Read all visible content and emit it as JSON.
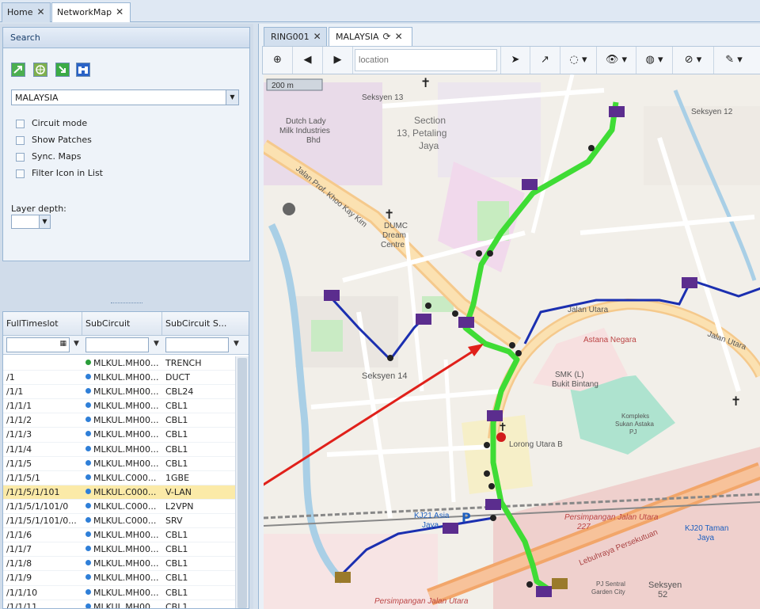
{
  "top_tabs": [
    {
      "label": "Home",
      "active": false
    },
    {
      "label": "NetworkMap",
      "active": true
    }
  ],
  "search_panel": {
    "title": "Search",
    "tool_icons": [
      "export-icon",
      "globe-icon",
      "import-icon",
      "binoculars-icon"
    ],
    "country": "MALAYSIA",
    "options": [
      "Circuit mode",
      "Show Patches",
      "Sync. Maps",
      "Filter Icon in List"
    ],
    "layer_depth_label": "Layer depth:"
  },
  "grid": {
    "columns": [
      "FullTimeslot",
      "SubCircuit",
      "SubCircuit S..."
    ],
    "rows": [
      {
        "slot": "",
        "sub": "MLKUL.MH00...",
        "status": "TRENCH",
        "dot": "#2a9d3a",
        "selected": false
      },
      {
        "slot": "/1",
        "sub": "MLKUL.MH00...",
        "status": "DUCT",
        "dot": "#2f7fd8",
        "selected": false
      },
      {
        "slot": "/1/1",
        "sub": "MLKUL.MH00...",
        "status": "CBL24",
        "dot": "#2f7fd8",
        "selected": false
      },
      {
        "slot": "/1/1/1",
        "sub": "MLKUL.MH00...",
        "status": "CBL1",
        "dot": "#2f7fd8",
        "selected": false
      },
      {
        "slot": "/1/1/2",
        "sub": "MLKUL.MH00...",
        "status": "CBL1",
        "dot": "#2f7fd8",
        "selected": false
      },
      {
        "slot": "/1/1/3",
        "sub": "MLKUL.MH00...",
        "status": "CBL1",
        "dot": "#2f7fd8",
        "selected": false
      },
      {
        "slot": "/1/1/4",
        "sub": "MLKUL.MH00...",
        "status": "CBL1",
        "dot": "#2f7fd8",
        "selected": false
      },
      {
        "slot": "/1/1/5",
        "sub": "MLKUL.MH00...",
        "status": "CBL1",
        "dot": "#2f7fd8",
        "selected": false
      },
      {
        "slot": "/1/1/5/1",
        "sub": "MLKUL.C000...",
        "status": "1GBE",
        "dot": "#2f7fd8",
        "selected": false
      },
      {
        "slot": "/1/1/5/1/101",
        "sub": "MLKUL.C000...",
        "status": "V-LAN",
        "dot": "#2f7fd8",
        "selected": true
      },
      {
        "slot": "/1/1/5/1/101/0",
        "sub": "MLKUL.C000...",
        "status": "L2VPN",
        "dot": "#2f7fd8",
        "selected": false
      },
      {
        "slot": "/1/1/5/1/101/0...",
        "sub": "MLKUL.C000...",
        "status": "SRV",
        "dot": "#2f7fd8",
        "selected": false
      },
      {
        "slot": "/1/1/6",
        "sub": "MLKUL.MH00...",
        "status": "CBL1",
        "dot": "#2f7fd8",
        "selected": false
      },
      {
        "slot": "/1/1/7",
        "sub": "MLKUL.MH00...",
        "status": "CBL1",
        "dot": "#2f7fd8",
        "selected": false
      },
      {
        "slot": "/1/1/8",
        "sub": "MLKUL.MH00...",
        "status": "CBL1",
        "dot": "#2f7fd8",
        "selected": false
      },
      {
        "slot": "/1/1/9",
        "sub": "MLKUL.MH00...",
        "status": "CBL1",
        "dot": "#2f7fd8",
        "selected": false
      },
      {
        "slot": "/1/1/10",
        "sub": "MLKUL.MH00...",
        "status": "CBL1",
        "dot": "#2f7fd8",
        "selected": false
      },
      {
        "slot": "/1/1/11",
        "sub": "MLKUL.MH00...",
        "status": "CBL1",
        "dot": "#2f7fd8",
        "selected": false
      }
    ]
  },
  "map_tabs": [
    {
      "label": "RING001",
      "active": false
    },
    {
      "label": "MALAYSIA",
      "active": true
    }
  ],
  "map_toolbar": {
    "location_placeholder": "location",
    "buttons": [
      "zoom-in-icon",
      "back-icon",
      "forward-icon",
      "locate-icon",
      "external-link-icon",
      "select-icon",
      "view-icon",
      "globe-icon",
      "visibility-icon",
      "edit-icon"
    ]
  },
  "map": {
    "scale": "200 m",
    "labels": {
      "seksyen13": "Seksyen 13",
      "dutch_lady": [
        "Dutch Lady",
        "Milk Industries",
        "Bhd"
      ],
      "section13": [
        "Section",
        "13, Petaling",
        "Jaya"
      ],
      "seksyen12": "Seksyen 12",
      "dumc": [
        "DUMC",
        "Dream",
        "Centre"
      ],
      "khoo_kay_kim": "Jalan Prof. Khoo Kay Kim",
      "jalan_utara": "Jalan Utara",
      "jalan_utara_2": "Jalan Utara",
      "istana": "Astana Negara",
      "smk": [
        "SMK (L)",
        "Bukit Bintang"
      ],
      "seksyen14": "Seksyen 14",
      "lorong_utara_b": "Lorong Utara B",
      "kompleks": [
        "Kompleks",
        "Sukan Astaka",
        "PJ"
      ],
      "persekutuan": "Lebuhraya Persekutuan",
      "persimpangan": [
        "Persimpangan Jalan Utara",
        "227"
      ],
      "kj21": [
        "KJ21 Asia",
        "Jaya"
      ],
      "kj20": [
        "KJ20 Taman",
        "Jaya"
      ],
      "seksyen52": [
        "Seksyen",
        "52"
      ],
      "persimpangan_bottom": "Persimpangan Jalan Utara",
      "pj_sentral": [
        "PJ Sentral",
        "Garden City"
      ]
    },
    "colors": {
      "route_green": "#3fdc35",
      "route_blue": "#1b2fb0",
      "node_purple": "#5b2d8e",
      "arrow_red": "#e0201a"
    }
  }
}
